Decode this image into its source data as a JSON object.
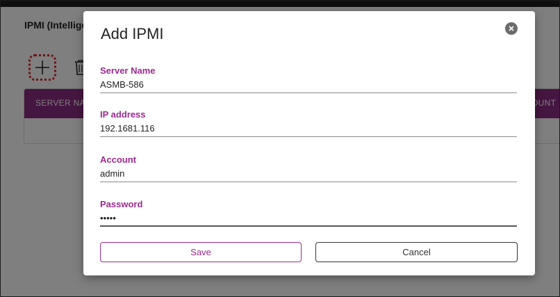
{
  "background_page": {
    "title": "IPMI (Intellige",
    "table": {
      "columns": [
        "SERVER NAM",
        "OUNT"
      ]
    }
  },
  "modal": {
    "title": "Add IPMI",
    "fields": {
      "server_name": {
        "label": "Server Name",
        "value": "ASMB-586"
      },
      "ip_address": {
        "label": "IP address",
        "value": "192.1681.116"
      },
      "account": {
        "label": "Account",
        "value": "admin"
      },
      "password": {
        "label": "Password",
        "value": "•••••"
      }
    },
    "buttons": {
      "save": "Save",
      "cancel": "Cancel"
    }
  },
  "colors": {
    "accent": "#9c2a90",
    "table_header": "#8a2c83",
    "highlight_dotted": "#e02020"
  },
  "icons": [
    "plus-icon",
    "trash-icon",
    "close-icon"
  ]
}
